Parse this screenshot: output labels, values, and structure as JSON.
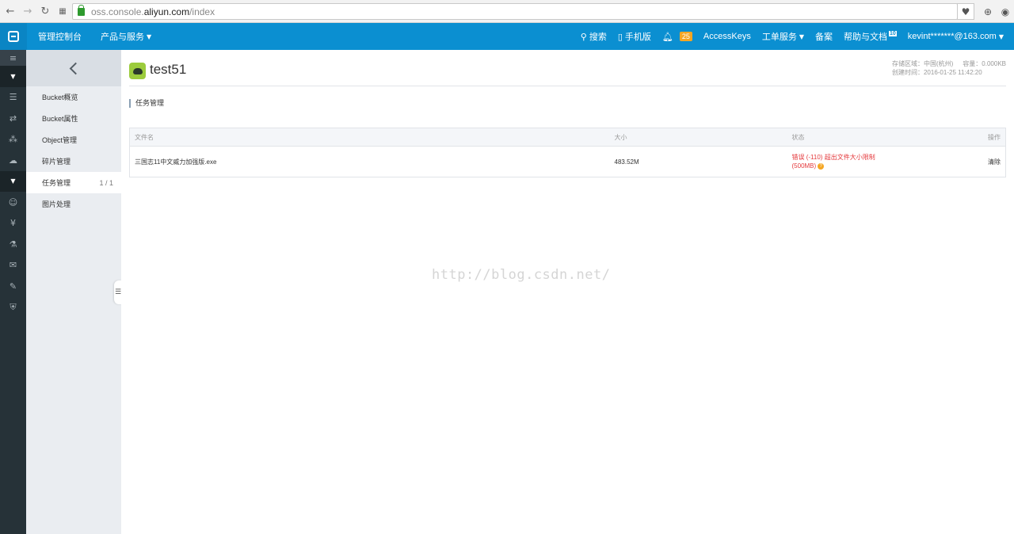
{
  "browser": {
    "url_prefix": "oss.console.",
    "url_host": "aliyun.com",
    "url_path": "/index"
  },
  "topnav": {
    "console": "管理控制台",
    "products": "产品与服务",
    "search": "搜索",
    "mobile": "手机版",
    "notif_count": "25",
    "accesskeys": "AccessKeys",
    "tickets": "工单服务",
    "beian": "备案",
    "help": "帮助与文档",
    "help_badge": "10",
    "user": "kevint*******@163.com"
  },
  "subside": {
    "items": [
      {
        "label": "Bucket概览"
      },
      {
        "label": "Bucket属性"
      },
      {
        "label": "Object管理"
      },
      {
        "label": "碎片管理"
      },
      {
        "label": "任务管理",
        "count": "1 / 1"
      },
      {
        "label": "图片处理"
      }
    ]
  },
  "bucket": {
    "name": "test51",
    "region_label": "存储区域：中国(杭州)",
    "capacity_label": "容量：0.000KB",
    "created_label": "创建时间：2016-01-25 11:42:20"
  },
  "section_title": "任务管理",
  "table": {
    "headers": {
      "name": "文件名",
      "size": "大小",
      "status": "状态",
      "action": "操作"
    },
    "rows": [
      {
        "name": "三国志11中文威力加强版.exe",
        "size": "483.52M",
        "status_line1": "错误 (-110) 超出文件大小限制",
        "status_line2": "(500MB)",
        "action": "清除"
      }
    ]
  },
  "watermark": "http://blog.csdn.net/",
  "colors": {
    "topnav": "#0b8fd1",
    "rail": "#263238",
    "subside": "#eaedf1",
    "error": "#e4393c",
    "bucket_icon": "#9ccc3d"
  }
}
